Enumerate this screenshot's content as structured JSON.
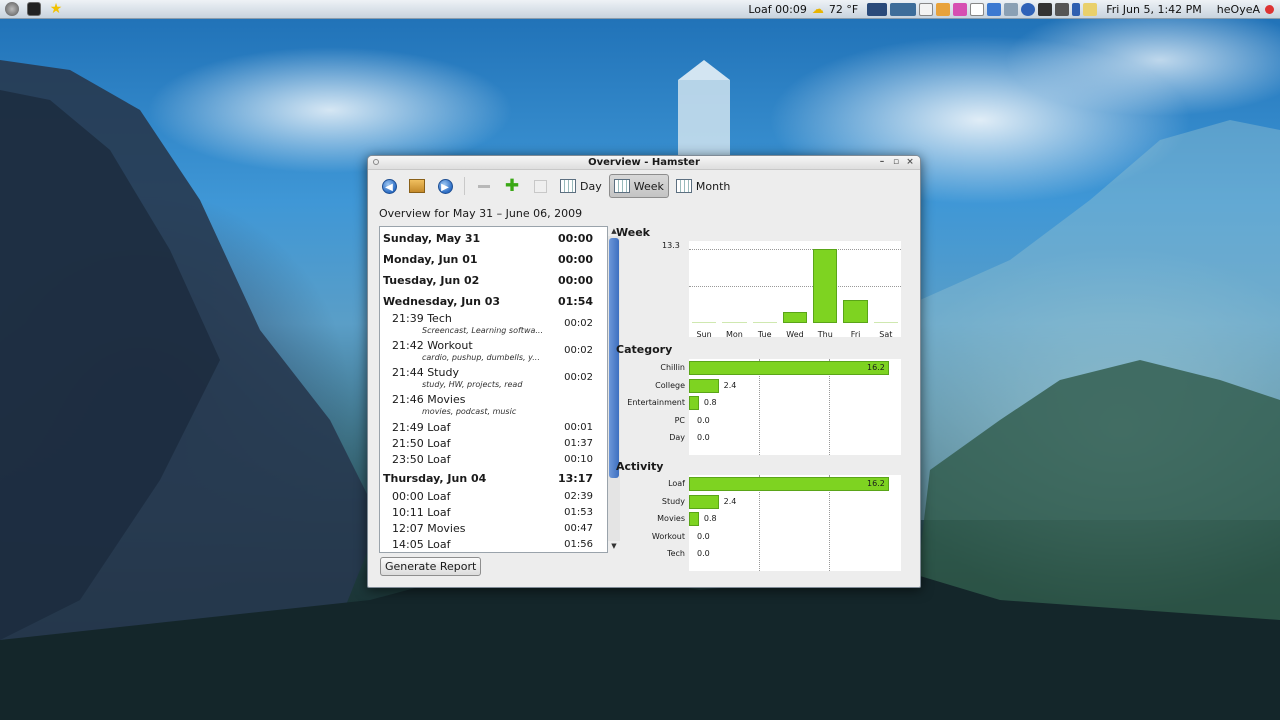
{
  "panel": {
    "status_text": "Loaf 00:09",
    "weather": "72 °F",
    "datetime": "Fri Jun  5,  1:42 PM",
    "user": "heOyeA"
  },
  "window": {
    "title": "Overview - Hamster",
    "views": {
      "day": "Day",
      "week": "Week",
      "month": "Month"
    },
    "active_view": "Week",
    "overview_label": "Overview for May 31 – June 06, 2009",
    "generate_report": "Generate Report"
  },
  "facts": [
    {
      "type": "day",
      "label": "Sunday, May 31",
      "total": "00:00"
    },
    {
      "type": "day",
      "label": "Monday, Jun 01",
      "total": "00:00"
    },
    {
      "type": "day",
      "label": "Tuesday, Jun 02",
      "total": "00:00"
    },
    {
      "type": "day",
      "label": "Wednesday, Jun 03",
      "total": "01:54"
    },
    {
      "type": "fact",
      "label": "21:39 Tech",
      "tags": "Screencast, Learning softwa...",
      "duration": "00:02"
    },
    {
      "type": "fact",
      "label": "21:42 Workout",
      "tags": "cardio, pushup, dumbells, y...",
      "duration": "00:02"
    },
    {
      "type": "fact",
      "label": "21:44 Study",
      "tags": "study, HW, projects, read",
      "duration": "00:02"
    },
    {
      "type": "fact",
      "label": "21:46 Movies",
      "tags": "movies, podcast, music",
      "duration": ""
    },
    {
      "type": "fact",
      "label": "21:49 Loaf",
      "tags": "",
      "duration": "00:01"
    },
    {
      "type": "fact",
      "label": "21:50 Loaf",
      "tags": "",
      "duration": "01:37"
    },
    {
      "type": "fact",
      "label": "23:50 Loaf",
      "tags": "",
      "duration": "00:10"
    },
    {
      "type": "day",
      "label": "Thursday, Jun 04",
      "total": "13:17"
    },
    {
      "type": "fact",
      "label": "00:00 Loaf",
      "tags": "",
      "duration": "02:39"
    },
    {
      "type": "fact",
      "label": "10:11 Loaf",
      "tags": "",
      "duration": "01:53"
    },
    {
      "type": "fact",
      "label": "12:07 Movies",
      "tags": "",
      "duration": "00:47"
    },
    {
      "type": "fact",
      "label": "14:05 Loaf",
      "tags": "",
      "duration": "01:56"
    }
  ],
  "charts": {
    "week_title": "Week",
    "category_title": "Category",
    "activity_title": "Activity"
  },
  "chart_data": [
    {
      "type": "bar",
      "title": "Week",
      "categories": [
        "Sun",
        "Mon",
        "Tue",
        "Wed",
        "Thu",
        "Fri",
        "Sat"
      ],
      "values": [
        0,
        0,
        0,
        1.9,
        13.3,
        4.1,
        0
      ],
      "y_max_label": "13.3",
      "ylim": [
        0,
        13.3
      ],
      "color": "#7ed321"
    },
    {
      "type": "bar",
      "orientation": "horizontal",
      "title": "Category",
      "categories": [
        "Chillin",
        "College",
        "Entertainment",
        "PC",
        "Day"
      ],
      "values": [
        16.2,
        2.4,
        0.8,
        0.0,
        0.0
      ],
      "labels": [
        "16.2",
        "2.4",
        "0.8",
        "0.0",
        "0.0"
      ],
      "xlim": [
        0,
        16.2
      ],
      "color": "#7ed321"
    },
    {
      "type": "bar",
      "orientation": "horizontal",
      "title": "Activity",
      "categories": [
        "Loaf",
        "Study",
        "Movies",
        "Workout",
        "Tech"
      ],
      "values": [
        16.2,
        2.4,
        0.8,
        0.0,
        0.0
      ],
      "labels": [
        "16.2",
        "2.4",
        "0.8",
        "0.0",
        "0.0"
      ],
      "xlim": [
        0,
        16.2
      ],
      "color": "#7ed321"
    }
  ]
}
